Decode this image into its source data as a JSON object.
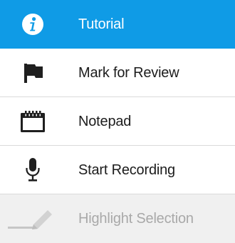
{
  "menu": {
    "items": [
      {
        "label": "Tutorial",
        "icon": "info-icon",
        "state": "active"
      },
      {
        "label": "Mark for Review",
        "icon": "flag-icon",
        "state": "normal"
      },
      {
        "label": "Notepad",
        "icon": "notepad-icon",
        "state": "normal"
      },
      {
        "label": "Start Recording",
        "icon": "microphone-icon",
        "state": "normal"
      },
      {
        "label": "Highlight Selection",
        "icon": "highlighter-pen-icon",
        "state": "disabled"
      }
    ]
  },
  "colors": {
    "active_background": "#0f9be6",
    "active_text": "#ffffff",
    "text": "#1c1c1c",
    "icon": "#1f1f1f",
    "disabled_background": "#f0f0f0",
    "disabled_text": "#a9a9a9",
    "divider": "#dadada"
  }
}
